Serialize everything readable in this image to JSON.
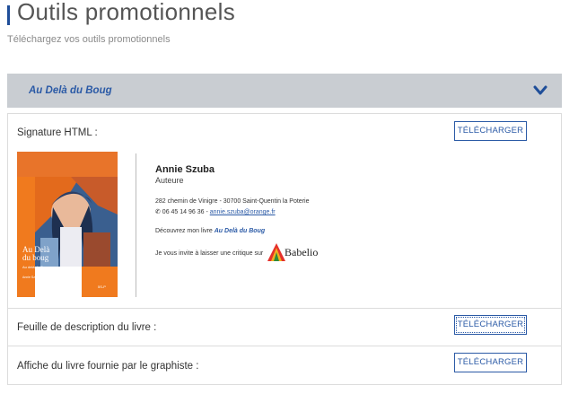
{
  "header": {
    "title": "Outils promotionnels",
    "subtitle": "Téléchargez vos outils promotionnels"
  },
  "accordion": {
    "title": "Au Delà du Boug",
    "icon": "chevron-down-icon"
  },
  "rows": [
    {
      "label": "Signature HTML :",
      "button": "TÉLÉCHARGER"
    },
    {
      "label": "Feuille de description du livre :",
      "button": "TÉLÉCHARGER"
    },
    {
      "label": "Affiche du livre fournie par le graphiste :",
      "button": "TÉLÉCHARGER"
    }
  ],
  "signature": {
    "name": "Annie Szuba",
    "role": "Auteure",
    "address": "282 chemin de Vinigre  - 30700  Saint-Quentin la Poterie",
    "phone": "✆ 06 45 14 96 36 - ",
    "email": "annie.szuba@orange.fr",
    "discover_prefix": "Découvrez mon livre ",
    "book_title": "Au Delà du Boug",
    "invite": "Je vous invite à laisser une critique sur",
    "babelio": "Babelio",
    "cover": {
      "title_line1": "Au Delà",
      "title_line2": "du boug",
      "subtitle": "Au delà du Boug",
      "author": "Annie Szuba",
      "publisher": "5S-P"
    }
  },
  "colors": {
    "accent": "#2b5aa6",
    "accordion_bg": "#c9cdd2",
    "cover_orange": "#f07a1e"
  }
}
